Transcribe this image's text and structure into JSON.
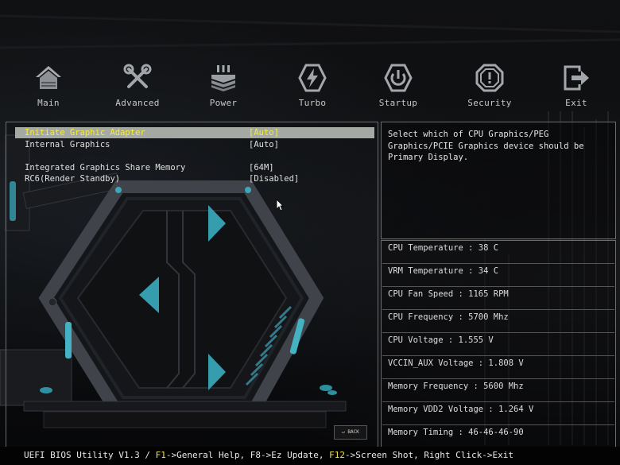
{
  "nav": {
    "items": [
      {
        "label": "Main",
        "icon": "home-icon"
      },
      {
        "label": "Advanced",
        "icon": "tools-icon"
      },
      {
        "label": "Power",
        "icon": "power-stack-icon"
      },
      {
        "label": "Turbo",
        "icon": "turbo-bolt-icon"
      },
      {
        "label": "Startup",
        "icon": "power-button-icon"
      },
      {
        "label": "Security",
        "icon": "security-octagon-icon"
      },
      {
        "label": "Exit",
        "icon": "exit-icon"
      }
    ]
  },
  "settings": {
    "rows": [
      {
        "name": "Initiate Graphic Adapter",
        "value": "[Auto]"
      },
      {
        "name": "Internal Graphics",
        "value": "[Auto]"
      },
      {
        "name": "Integrated Graphics Share Memory",
        "value": "[64M]"
      },
      {
        "name": "RC6(Render Standby)",
        "value": "[Disabled]"
      }
    ]
  },
  "help": {
    "text": "Select which of CPU Graphics/PEG Graphics/PCIE Graphics device should be Primary Display."
  },
  "hardware": {
    "rows": [
      "CPU Temperature : 38 C",
      "VRM Temperature : 34 C",
      "CPU Fan Speed : 1165 RPM",
      "CPU Frequency : 5700 Mhz",
      "CPU Voltage : 1.555 V",
      "VCCIN_AUX Voltage : 1.808 V",
      "Memory Frequency : 5600 Mhz",
      "Memory VDD2 Voltage : 1.264 V",
      "Memory Timing : 46-46-46-90"
    ]
  },
  "status": {
    "prefix": "UEFI BIOS Utility V1.3 / ",
    "f1": "F1",
    "f1_text": "->General Help, F8->Ez Update, ",
    "f12": "F12",
    "f12_text": "->Screen Shot, Right Click->Exit"
  },
  "back_label": "BACK",
  "colors": {
    "selected_bg": "#a5a9a3",
    "selected_text": "#f4ec3c",
    "accent_cyan": "#4fc6d8",
    "panel_border": "#6c6c6c"
  }
}
